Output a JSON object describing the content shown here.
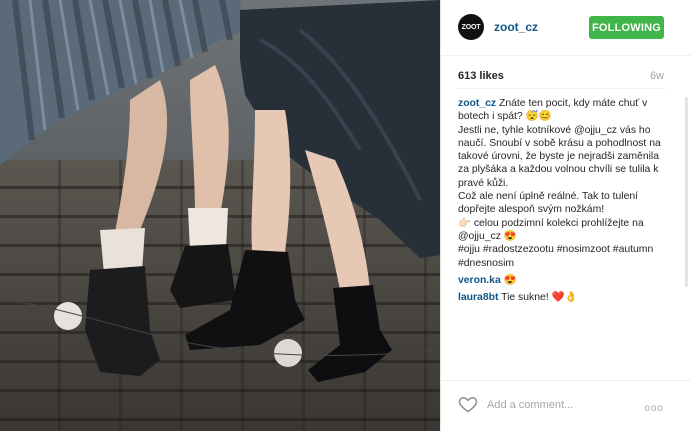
{
  "post": {
    "username": "zoot_cz",
    "avatar_text": "ZOOT",
    "follow_label": "FOLLOWING",
    "likes": "613 likes",
    "time": "6w"
  },
  "comments": [
    {
      "user": "zoot_cz",
      "text": "Znáte ten pocit, kdy máte chuť v botech i spát? 😴😊\nJestli ne, tyhle kotníkové @ojju_cz vás ho naučí. Snoubí v sobě krásu a pohodlnost na takové úrovni, že byste je nejradši zaměnila za plyšáka a každou volnou chvíli se tulila k pravé kůži.\nCož ale není úplně reálné. Tak to tulení dopřejte alespoň svým nožkám!\n👉🏻 celou podzimní kolekci prohlížejte na @ojju_cz 😍\n#ojju #radostzezootu #nosimzoot #autumn #dnesnosim"
    },
    {
      "user": "veron.ka",
      "text": "😍"
    },
    {
      "user": "laura8bt",
      "text": "Tie sukne! ❤️👌"
    }
  ],
  "add_comment_placeholder": "Add a comment...",
  "more_icon": "ooo",
  "colors": {
    "accent": "#125688",
    "follow": "#3fb54a"
  }
}
